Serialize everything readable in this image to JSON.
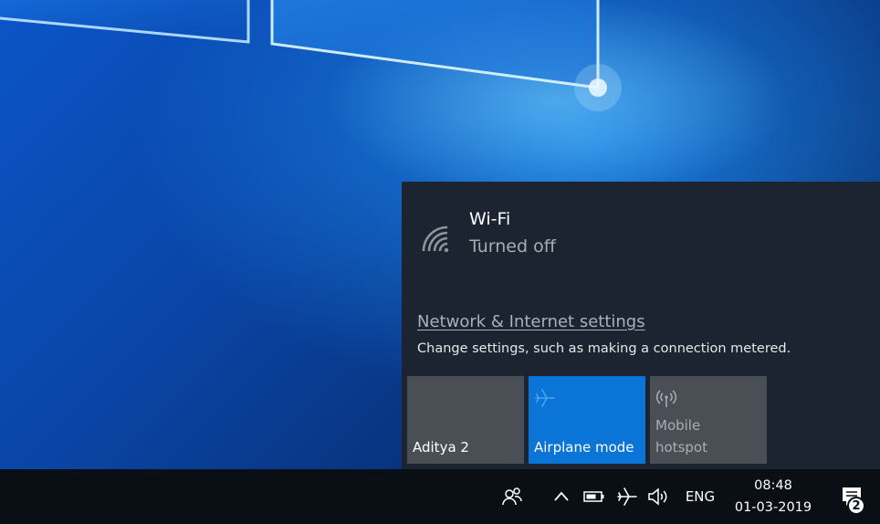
{
  "flyout": {
    "wifi": {
      "title": "Wi-Fi",
      "status": "Turned off",
      "icon": "wifi-off-icon"
    },
    "settings_link": "Network & Internet settings",
    "settings_description": "Change settings, such as making a connection metered.",
    "tiles": [
      {
        "label": "Aditya 2",
        "state": "inactive"
      },
      {
        "label": "Airplane mode",
        "icon": "airplane-icon",
        "state": "active"
      },
      {
        "label_line1": "Mobile",
        "label_line2": "hotspot",
        "icon": "hotspot-icon",
        "state": "disabled"
      }
    ]
  },
  "taskbar": {
    "language": "ENG",
    "time": "08:48",
    "date": "01-03-2019",
    "notification_count": "2",
    "icons": [
      "people-icon",
      "chevron-up-icon",
      "battery-icon",
      "airplane-icon",
      "volume-icon",
      "action-center-icon"
    ]
  },
  "colors": {
    "flyout_bg": "#1b2430",
    "active_tile": "#0a75d6",
    "inactive_tile": "#4a4f55",
    "taskbar_bg": "#0a0f16"
  }
}
